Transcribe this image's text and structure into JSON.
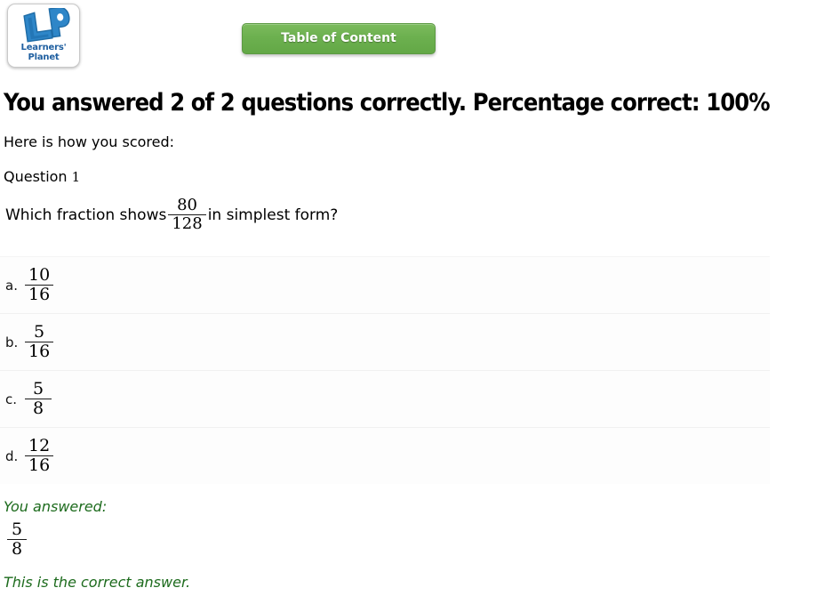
{
  "header": {
    "logo": {
      "mark_text": "LP",
      "wordmark": "Learners' Planet",
      "brand_color": "#2175ba"
    },
    "toc_button": {
      "label": "Table of Content",
      "color": "#6cb04f"
    }
  },
  "result": {
    "heading": "You answered 2 of 2 questions correctly. Percentage correct: 100%",
    "correct_count": "2",
    "total_count": "2",
    "percentage": "100%",
    "subheading": "Here is how you scored:"
  },
  "question": {
    "label_word": "Question",
    "label_number": "1",
    "text_before": "Which fraction shows",
    "fraction": {
      "numerator": "80",
      "denominator": "128"
    },
    "text_after": "in simplest form?",
    "options": [
      {
        "letter": "a.",
        "numerator": "10",
        "denominator": "16"
      },
      {
        "letter": "b.",
        "numerator": "5",
        "denominator": "16"
      },
      {
        "letter": "c.",
        "numerator": "5",
        "denominator": "8"
      },
      {
        "letter": "d.",
        "numerator": "12",
        "denominator": "16"
      }
    ]
  },
  "feedback": {
    "answered_label": "You answered:",
    "answer": {
      "numerator": "5",
      "denominator": "8"
    },
    "verdict": "This is the correct answer.",
    "verdict_color": "#1d6b1d"
  }
}
